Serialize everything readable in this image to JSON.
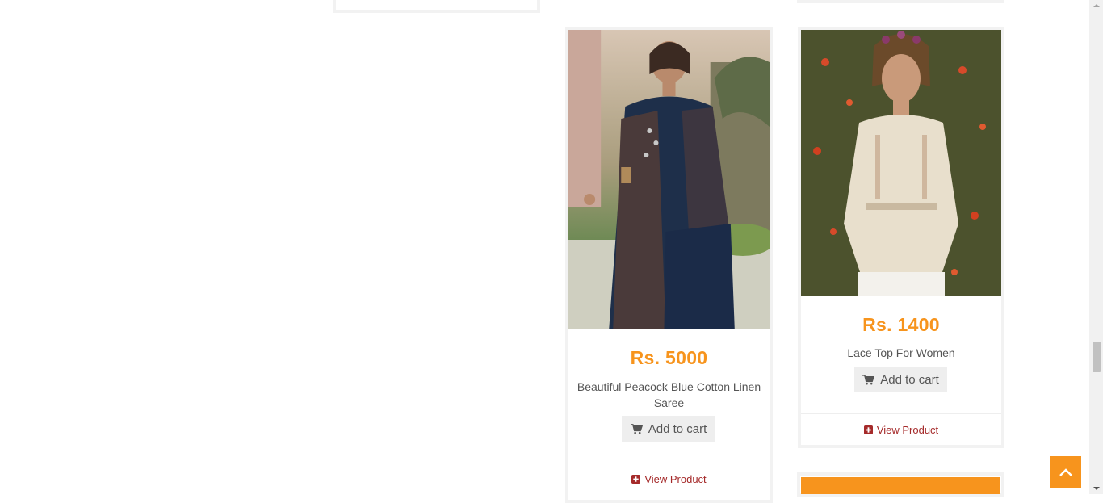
{
  "products": [
    {
      "price": "Rs. 5000",
      "name": "Beautiful Peacock Blue Cotton Linen Saree",
      "add_to_cart_label": "Add to cart",
      "view_product_label": "View Product",
      "image_alt": "saree-photo"
    },
    {
      "price": "Rs. 1400",
      "name": "Lace Top For Women",
      "add_to_cart_label": "Add to cart",
      "view_product_label": "View Product",
      "image_alt": "lace-top-photo"
    }
  ],
  "icons": {
    "cart": "shopping-cart-icon",
    "view": "plus-square-icon",
    "back_to_top": "chevron-up-icon"
  },
  "colors": {
    "price": "#f7941d",
    "view_link": "#a52a2a",
    "accent": "#f7941d",
    "card_border": "#f2f2f2"
  }
}
